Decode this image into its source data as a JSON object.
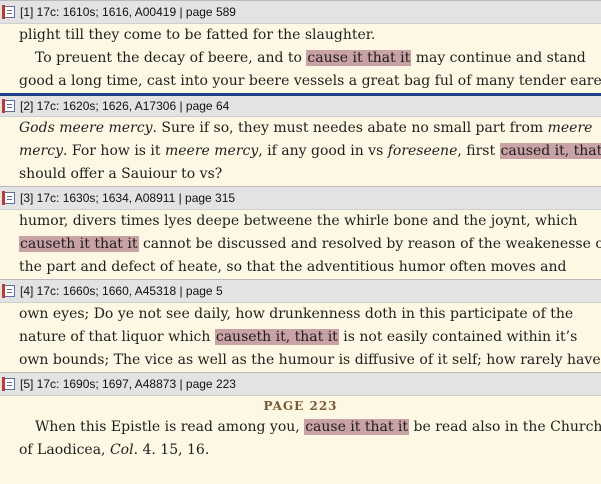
{
  "results": [
    {
      "header": "[1] 17c: 1610s; 1616, A00419 | page 589",
      "lines": [
        [
          {
            "t": "plight till they come to be fatted for the slaughter."
          }
        ],
        [
          {
            "t": "To preuent the decay of beere, and to "
          },
          {
            "t": "cause it that it",
            "h": true
          },
          {
            "t": " may continue and stand"
          }
        ],
        [
          {
            "t": "good a long time, cast into your beere vessels a great bag ful of many tender eares"
          }
        ]
      ]
    },
    {
      "header": "[2] 17c: 1620s; 1626, A17306 | page 64",
      "lines": [
        [
          {
            "t": "Gods meere mercy",
            "i": true
          },
          {
            "t": ". Sure if so, they must needes abate no small part from "
          },
          {
            "t": "meere",
            "i": true
          }
        ],
        [
          {
            "t": "mercy",
            "i": true
          },
          {
            "t": ". For how is it "
          },
          {
            "t": "meere mercy",
            "i": true
          },
          {
            "t": ", if any good in vs "
          },
          {
            "t": "foreseene",
            "i": true
          },
          {
            "t": ", first "
          },
          {
            "t": "caused it, that it",
            "h": true
          }
        ],
        [
          {
            "t": "should offer a Sauiour to vs?"
          }
        ]
      ]
    },
    {
      "header": "[3] 17c: 1630s; 1634, A08911 | page  315",
      "lines": [
        [
          {
            "t": "humor, divers times lyes deepe betweene the whirle bone and the joynt, which"
          }
        ],
        [
          {
            "t": "causeth it that it",
            "h": true
          },
          {
            "t": " cannot be discussed and resolved by reason of the weakenesse of"
          }
        ],
        [
          {
            "t": "the part and defect of heate, so that the adventitious humor often moves and"
          }
        ]
      ]
    },
    {
      "header": "[4] 17c: 1660s; 1660, A45318 | page  5",
      "lines": [
        [
          {
            "t": "own eyes; Do ye not see daily, how drunkenness doth in this participate of the"
          }
        ],
        [
          {
            "t": "nature of that liquor which "
          },
          {
            "t": "causeth it, that it",
            "h": true
          },
          {
            "t": " is not easily contained within it’s"
          }
        ],
        [
          {
            "t": "own bounds; The vice as well as the humour is diffusive of it self; how rarely have"
          }
        ]
      ]
    },
    {
      "header": "[5] 17c: 1690s; 1697, A48873 | page  223",
      "page_label": "PAGE  223",
      "lines": [
        [
          {
            "t": "When this Epistle is read among you, "
          },
          {
            "t": "cause it that it",
            "h": true
          },
          {
            "t": " be read also in the Church"
          }
        ],
        [
          {
            "t": "of Laodicea, "
          },
          {
            "t": "Col",
            "i": true
          },
          {
            "t": ". 4. 15, 16."
          }
        ]
      ]
    }
  ],
  "active_result": 1,
  "colors": {
    "highlight": "#c9a2a5",
    "background": "#fdf8e3",
    "header_bg": "#e3e3e3",
    "active_bar": "#1f3f86"
  },
  "icons": {
    "result_icon": "document-bookmark-icon"
  }
}
